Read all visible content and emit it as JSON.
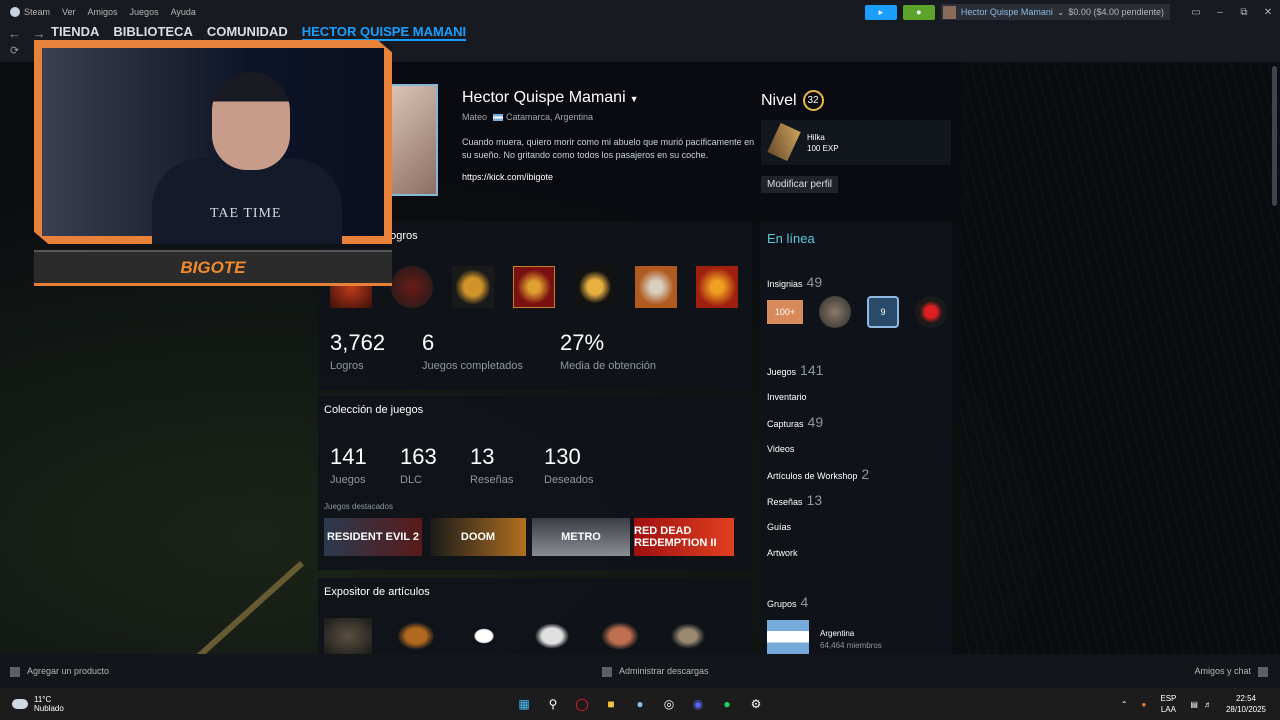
{
  "menu": {
    "app": "Steam",
    "items": [
      "Ver",
      "Amigos",
      "Juegos",
      "Ayuda"
    ],
    "account_name": "Hector Quispe Mamani",
    "wallet": "$0.00 ($4.00 pendiente)"
  },
  "nav": {
    "tabs": [
      "TIENDA",
      "BIBLIOTECA",
      "COMUNIDAD",
      "HECTOR QUISPE MAMANI"
    ]
  },
  "profile": {
    "name": "Hector Quispe Mamani",
    "real_name": "Mateo",
    "location": "Catamarca, Argentina",
    "summary": "Cuando muera, quiero morir como mi abuelo que murió pacíficamente en su sueño. No gritando como todos los pasajeros en su coche.",
    "link": "https://kick.com/ibigote",
    "level_label": "Nivel",
    "level": "32",
    "badge_name": "Hilka",
    "badge_xp": "100 EXP",
    "edit_label": "Modificar perfil"
  },
  "achievements": {
    "title": "Logros",
    "stats": [
      {
        "value": "3,762",
        "label": "Logros"
      },
      {
        "value": "6",
        "label": "Juegos completados"
      },
      {
        "value": "27%",
        "label": "Media de obtención"
      }
    ]
  },
  "games": {
    "title": "Colección de juegos",
    "stats": [
      {
        "value": "141",
        "label": "Juegos"
      },
      {
        "value": "163",
        "label": "DLC"
      },
      {
        "value": "13",
        "label": "Reseñas"
      },
      {
        "value": "130",
        "label": "Deseados"
      }
    ],
    "featured_label": "Juegos destacados",
    "featured": [
      "RESIDENT EVIL 2",
      "DOOM",
      "METRO",
      "RED DEAD REDEMPTION II"
    ]
  },
  "items": {
    "title": "Expositor de artículos"
  },
  "sidebar": {
    "status": "En línea",
    "badges_label": "Insignias",
    "badges_count": "49",
    "badge_text": "100+",
    "badge_num": "9",
    "games_label": "Juegos",
    "games_count": "141",
    "inventory": "Inventario",
    "screenshots_label": "Capturas",
    "screenshots_count": "49",
    "videos": "Videos",
    "workshop_label": "Artículos de Workshop",
    "workshop_count": "2",
    "reviews_label": "Reseñas",
    "reviews_count": "13",
    "guides": "Guías",
    "artwork": "Artwork",
    "groups_label": "Grupos",
    "groups_count": "4",
    "group_name": "Argentina",
    "group_members": "64,464 miembros"
  },
  "overlay": {
    "shirt_text": "TAE TIME",
    "banner": "BIGOTE"
  },
  "footer": {
    "add_product": "Agregar un producto",
    "downloads": "Administrar descargas",
    "friends": "Amigos y chat"
  },
  "taskbar": {
    "temp": "11°C",
    "weather": "Nublado",
    "lang1": "ESP",
    "lang2": "LAA",
    "time": "22:54",
    "date": "28/10/2025"
  },
  "colors": {
    "accent": "#1a9fff",
    "online": "#57cbde",
    "overlay_orange": "#e8823a"
  }
}
